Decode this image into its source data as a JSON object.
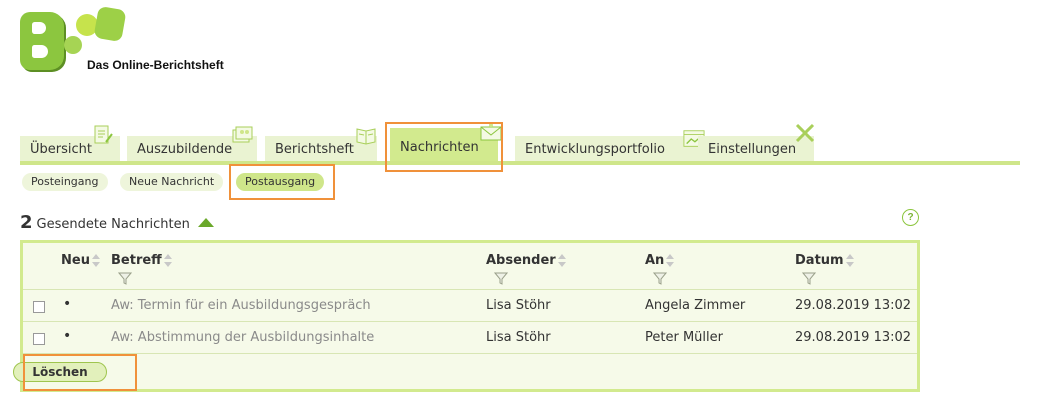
{
  "app": {
    "logo_text": "Das Online-Berichtsheft"
  },
  "tabs": [
    {
      "label": "Übersicht",
      "icon": "document-pen-icon"
    },
    {
      "label": "Auszubildende",
      "icon": "people-photo-icon"
    },
    {
      "label": "Berichtsheft",
      "icon": "open-book-icon"
    },
    {
      "label": "Nachrichten",
      "icon": "envelope-icon",
      "active": true
    },
    {
      "label": "Entwicklungsportfolio",
      "icon": "chart-window-icon"
    },
    {
      "label": "Einstellungen",
      "icon": "tools-icon"
    }
  ],
  "subtabs": [
    {
      "label": "Posteingang"
    },
    {
      "label": "Neue Nachricht"
    },
    {
      "label": "Postausgang",
      "active": true
    }
  ],
  "messages": {
    "count": "2",
    "label": "Gesendete Nachrichten",
    "help": "?",
    "columns": {
      "neu": "Neu",
      "betreff": "Betreff",
      "absender": "Absender",
      "an": "An",
      "datum": "Datum"
    },
    "rows": [
      {
        "neu": "•",
        "betreff": "Aw: Termin für ein Ausbildungsgespräch",
        "absender": "Lisa Stöhr",
        "an": "Angela Zimmer",
        "datum": "29.08.2019 13:02"
      },
      {
        "neu": "•",
        "betreff": "Aw: Abstimmung der Ausbildungsinhalte",
        "absender": "Lisa Stöhr",
        "an": "Peter Müller",
        "datum": "29.08.2019 13:02"
      }
    ],
    "delete_label": "Löschen"
  },
  "colors": {
    "accent": "#cfe68a",
    "active_tab": "#d2ea8e",
    "highlight": "#f0913a",
    "logo_green": "#8cc63f"
  }
}
